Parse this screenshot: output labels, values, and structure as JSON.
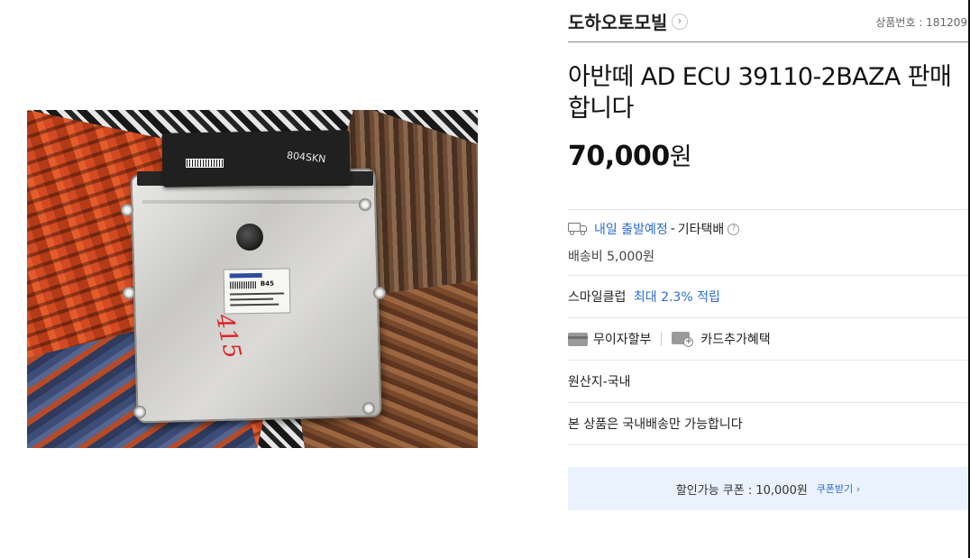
{
  "product_image": {
    "alt": "ECU photo",
    "label_code": "B45",
    "handwritten_text": "804SKN"
  },
  "seller": {
    "name": "도하오토모빌",
    "chevron": "›"
  },
  "product_number": "상품번호 : 181209",
  "title": "아반떼 AD ECU 39110-2BAZA 판매합니다",
  "price": {
    "value": "70,000",
    "unit": "원"
  },
  "shipping": {
    "date_text": "내일 출발예정",
    "separator": "-",
    "method": "기타택배",
    "help": "?",
    "fee": "배송비 5,000원"
  },
  "smileclub": {
    "label": "스마일클럽",
    "benefit": "최대 2.3% 적립"
  },
  "payment": {
    "installment": "무이자할부",
    "card_benefit": "카드추가혜택"
  },
  "origin": "원산지-국내",
  "domestic_notice": "본 상품은 국내배송만 가능합니다",
  "coupon": {
    "text": "할인가능 쿠폰 : 10,000원",
    "link": "쿠폰받기 ›"
  },
  "colors": {
    "accent_blue": "#2b6cd4",
    "coupon_bg": "#eaf2fd",
    "marker_red": "#e1202a"
  }
}
